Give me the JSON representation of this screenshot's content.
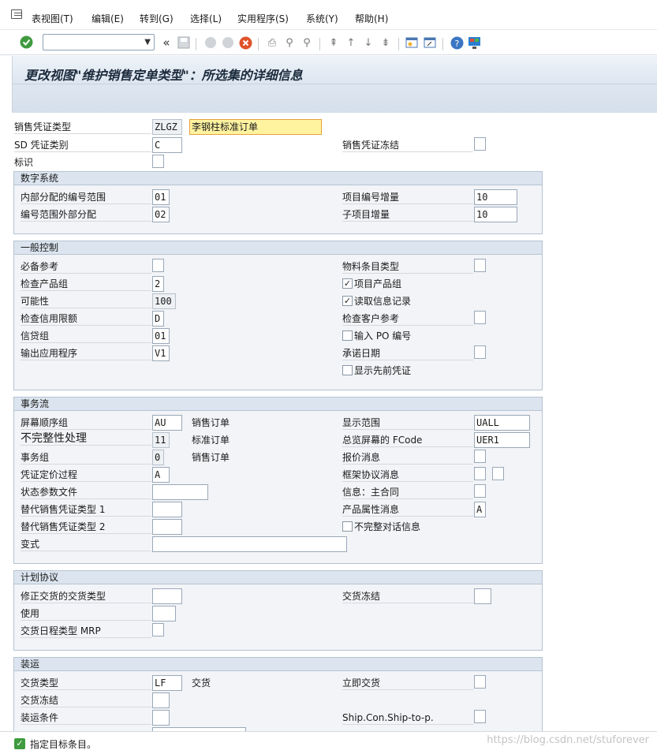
{
  "menu": [
    "表视图(T)",
    "编辑(E)",
    "转到(G)",
    "选择(L)",
    "实用程序(S)",
    "系统(Y)",
    "帮助(H)"
  ],
  "icons": {
    "enter": "check-icon",
    "back": "double-left-arrow-icon",
    "save": "save-icon",
    "help": "help-icon"
  },
  "title": "更改视图\"维护销售定单类型\"：所选集的详细信息",
  "header": {
    "doc_type_label": "销售凭证类型",
    "doc_type_value": "ZLGZ",
    "doc_type_desc": "李钢柱标准订单",
    "sd_cat_label": "SD 凭证类别",
    "sd_cat_value": "C",
    "block_label": "销售凭证冻结",
    "indicator_label": "标识"
  },
  "numbering": {
    "title": "数字系统",
    "int_range_label": "内部分配的编号范围",
    "int_range_value": "01",
    "ext_range_label": "编号范围外部分配",
    "ext_range_value": "02",
    "item_incr_label": "项目编号增量",
    "item_incr_value": "10",
    "sub_incr_label": "子项目增量",
    "sub_incr_value": "10"
  },
  "general": {
    "title": "一般控制",
    "ref_mand_label": "必备参考",
    "div_check_label": "检查产品组",
    "div_check_value": "2",
    "prob_label": "可能性",
    "prob_value": "100",
    "credit_label": "检查信用限额",
    "credit_value": "D",
    "credit_grp_label": "信贷组",
    "credit_grp_value": "01",
    "output_app_label": "输出应用程序",
    "output_app_value": "V1",
    "mat_entry_label": "物料条目类型",
    "item_div_label": "项目产品组",
    "read_info_label": "读取信息记录",
    "cust_ref_label": "检查客户参考",
    "po_num_label": "输入 PO 编号",
    "commit_date_label": "承诺日期",
    "show_prev_label": "显示先前凭证"
  },
  "flow": {
    "title": "事务流",
    "screen_seq_label": "屏幕顺序组",
    "screen_seq_value": "AU",
    "screen_seq_desc": "销售订单",
    "incomp_label": "不完整性处理",
    "incomp_value": "11",
    "incomp_desc": "标准订单",
    "trans_grp_label": "事务组",
    "trans_grp_value": "0",
    "trans_grp_desc": "销售订单",
    "pricing_label": "凭证定价过程",
    "pricing_value": "A",
    "status_prof_label": "状态参数文件",
    "alt_type1_label": "替代销售凭证类型 1",
    "alt_type2_label": "替代销售凭证类型 2",
    "variant_label": "变式",
    "disp_range_label": "显示范围",
    "disp_range_value": "UALL",
    "fcode_label": "总览屏幕的 FCode",
    "fcode_value": "UER1",
    "quot_msg_label": "报价消息",
    "outline_msg_label": "框架协议消息",
    "master_contr_label": "信息：主合同",
    "prod_attr_label": "产品属性消息",
    "prod_attr_value": "A",
    "incomp_dialog_label": "不完整对话信息"
  },
  "schedule": {
    "title": "计划协议",
    "corr_deliv_label": "修正交货的交货类型",
    "usage_label": "使用",
    "mrp_label": "交货日程类型 MRP",
    "deliv_block_label": "交货冻结"
  },
  "shipping": {
    "title": "装运",
    "deliv_type_label": "交货类型",
    "deliv_type_value": "LF",
    "deliv_type_desc": "交货",
    "deliv_block_label": "交货冻结",
    "ship_cond_label": "装运条件",
    "immed_deliv_label": "立即交货",
    "ship_con_label": "Ship.Con.Ship-to-p."
  },
  "status": {
    "message": "指定目标条目。"
  },
  "watermark": "https://blog.csdn.net/stuforever"
}
